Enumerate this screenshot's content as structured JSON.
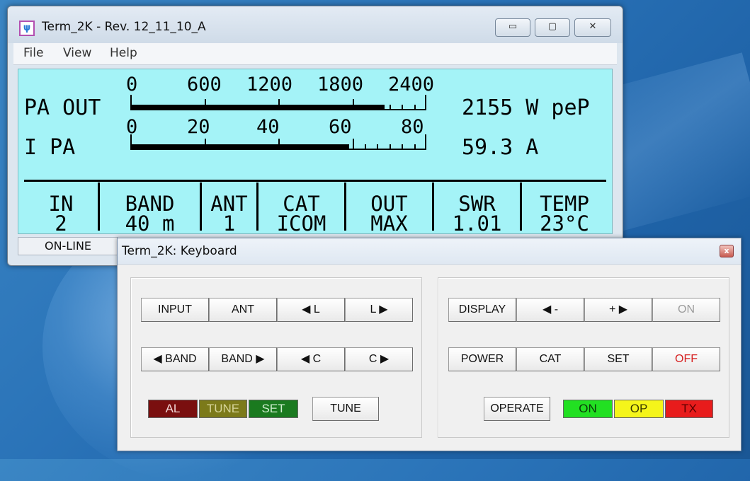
{
  "main_window": {
    "title": "Term_2K - Rev. 12_11_10_A",
    "controls": {
      "minimize": "▭",
      "maximize": "▢",
      "close": "✕"
    },
    "menu": [
      "File",
      "View",
      "Help"
    ],
    "display": {
      "pa_out": {
        "label": "PA OUT",
        "scale": [
          "0",
          "600",
          "1200",
          "1800",
          "2400"
        ],
        "value": "2155 W peP",
        "level": 0.86
      },
      "i_pa": {
        "label": "I PA",
        "scale": [
          "0",
          "20",
          "40",
          "60",
          "80"
        ],
        "value": "59.3 A",
        "level": 0.74
      },
      "cells": [
        {
          "head": "IN",
          "value": "2"
        },
        {
          "head": "BAND",
          "value": "40 m"
        },
        {
          "head": "ANT",
          "value": "1"
        },
        {
          "head": "CAT",
          "value": "ICOM"
        },
        {
          "head": "OUT",
          "value": "MAX"
        },
        {
          "head": "SWR",
          "value": "1.01"
        },
        {
          "head": "TEMP",
          "value": "23°C"
        }
      ]
    },
    "status": "ON-LINE"
  },
  "keyboard": {
    "title": "Term_2K: Keyboard",
    "close": "x",
    "left": {
      "input": "INPUT",
      "ant": "ANT",
      "l_down": "◀ L",
      "l_up": "L ▶",
      "band_down": "◀ BAND",
      "band_up": "BAND ▶",
      "c_down": "◀ C",
      "c_up": "C ▶",
      "tune": "TUNE",
      "leds": {
        "al": "AL",
        "tune": "TUNE",
        "set": "SET"
      }
    },
    "right": {
      "display": "DISPLAY",
      "minus": "◀ -",
      "plus": "+ ▶",
      "on": "ON",
      "power": "POWER",
      "cat": "CAT",
      "set": "SET",
      "off": "OFF",
      "operate": "OPERATE",
      "leds": {
        "on": "ON",
        "op": "OP",
        "tx": "TX"
      }
    },
    "colors": {
      "al_bg": "#7a0f0f",
      "tune_bg": "#7c7a1a",
      "set_bg": "#1a7a1f",
      "on_bg": "#22e022",
      "op_bg": "#f5f51a",
      "tx_bg": "#e81c1c"
    }
  }
}
